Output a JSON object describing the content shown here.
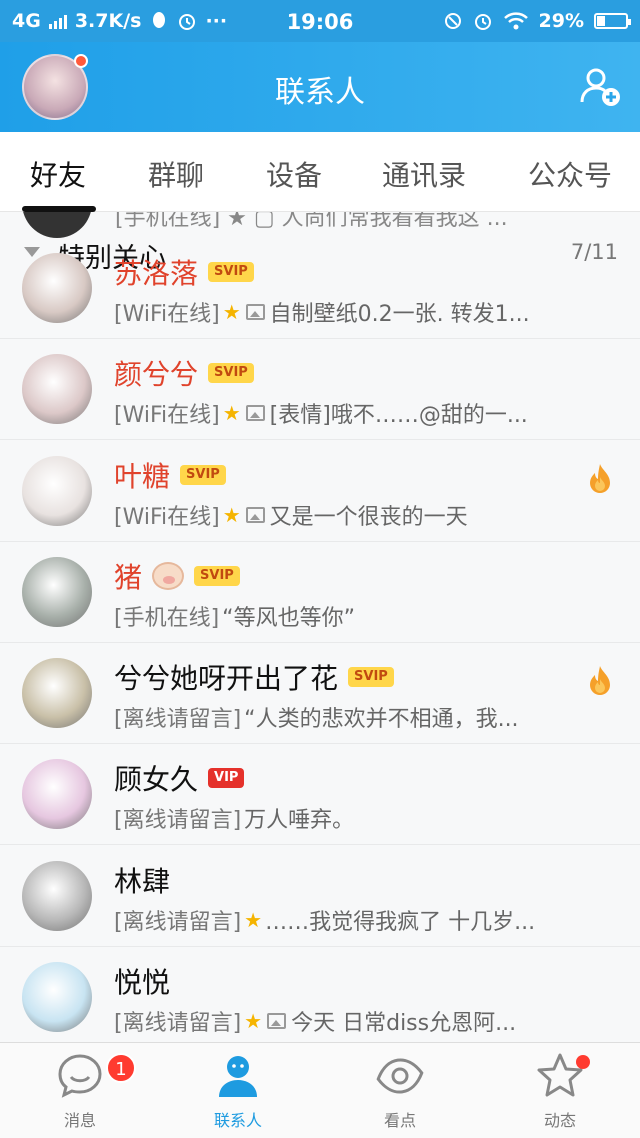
{
  "status_bar": {
    "network": "4G",
    "speed": "3.7K/s",
    "more": "···",
    "time": "19:06",
    "battery": "29%",
    "battery_level": 0.29
  },
  "header": {
    "title": "联系人"
  },
  "tabs": [
    {
      "label": "好友",
      "active": true
    },
    {
      "label": "群聊",
      "active": false
    },
    {
      "label": "设备",
      "active": false
    },
    {
      "label": "通讯录",
      "active": false
    },
    {
      "label": "公众号",
      "active": false
    }
  ],
  "partial_row": {
    "text": "[手机在线] ★ ▢ 人尚们常我看看我这 ..."
  },
  "group": {
    "name": "特别关心",
    "count": "7/11"
  },
  "contacts": [
    {
      "name": "苏洛落",
      "badge": "SVIP",
      "vip_name": true,
      "status": "[WiFi在线]",
      "star": true,
      "img": true,
      "signature": "自制壁纸0.2一张. 转发1...",
      "flame": false,
      "avatar_color": "#d8c9c4"
    },
    {
      "name": "颜兮兮",
      "badge": "SVIP",
      "vip_name": true,
      "status": "[WiFi在线]",
      "star": true,
      "img": true,
      "signature": "[表情]哦不……@甜的一...",
      "flame": false,
      "avatar_color": "#dcc8c8"
    },
    {
      "name": "叶糖",
      "badge": "SVIP",
      "vip_name": true,
      "status": "[WiFi在线]",
      "star": true,
      "img": true,
      "signature": "又是一个很丧的一天",
      "flame": true,
      "avatar_color": "#e8e2e0"
    },
    {
      "name": "猪",
      "badge": "SVIP",
      "vip_name": true,
      "pig": true,
      "status": "[手机在线]",
      "star": false,
      "img": false,
      "signature": "“等风也等你”",
      "flame": false,
      "avatar_color": "#a8b0aa"
    },
    {
      "name": "兮兮她呀开出了花",
      "badge": "SVIP",
      "vip_name": false,
      "status": "[离线请留言]",
      "star": false,
      "img": false,
      "signature": "“人类的悲欢并不相通，我...",
      "flame": true,
      "avatar_color": "#c9c0a8"
    },
    {
      "name": "顾女久",
      "badge": "VIP",
      "vip_name": false,
      "status": "[离线请留言]",
      "star": false,
      "img": false,
      "signature": "万人唾弃。",
      "flame": false,
      "avatar_color": "#e6c7e0"
    },
    {
      "name": "林肆",
      "badge": "",
      "vip_name": false,
      "status": "[离线请留言]",
      "star": true,
      "img": false,
      "signature": "……我觉得我疯了 十几岁...",
      "flame": false,
      "avatar_color": "#b8b8b8"
    },
    {
      "name": "悦悦",
      "badge": "",
      "vip_name": false,
      "status": "[离线请留言]",
      "star": true,
      "img": true,
      "signature": "今天 日常diss允恩阿...",
      "flame": false,
      "avatar_color": "#c8e4f2"
    }
  ],
  "bottom_nav": [
    {
      "label": "消息",
      "icon": "chat-bubble-icon",
      "badge": "1",
      "active": false
    },
    {
      "label": "联系人",
      "icon": "contacts-person-icon",
      "badge": "",
      "active": true
    },
    {
      "label": "看点",
      "icon": "eye-icon",
      "badge": "",
      "active": false
    },
    {
      "label": "动态",
      "icon": "star-icon",
      "badge": "dot",
      "active": false
    }
  ],
  "colors": {
    "accent": "#1f9fe8",
    "vip_red": "#e0432c",
    "svip_yellow": "#ffd64a"
  }
}
